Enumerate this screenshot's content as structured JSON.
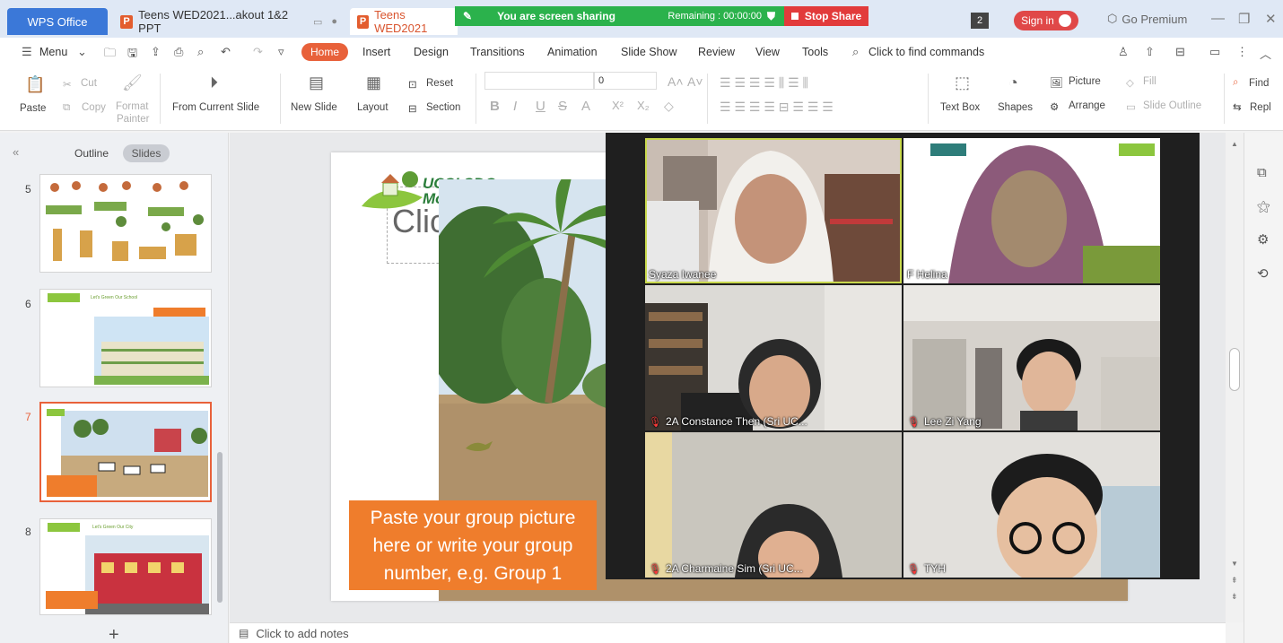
{
  "titlebar": {
    "app_tab": "WPS Office",
    "doc_tab_1": "Teens WED2021...akout 1&2 PPT",
    "doc_tab_2": "Teens WED2021",
    "share_text": "You are screen sharing",
    "remaining": "Remaining : 00:00:00",
    "stop_share": "Stop Share",
    "window_count": "2",
    "sign_in": "Sign in",
    "premium": "Go Premium"
  },
  "menu": {
    "menu_label": "Menu",
    "tabs": [
      "Home",
      "Insert",
      "Design",
      "Transitions",
      "Animation",
      "Slide Show",
      "Review",
      "View",
      "Tools"
    ],
    "search": "Click to find commands"
  },
  "toolbar": {
    "paste": "Paste",
    "cut": "Cut",
    "copy": "Copy",
    "format_painter_1": "Format",
    "format_painter_2": "Painter",
    "from_current": "From Current Slide",
    "new_slide": "New Slide",
    "layout": "Layout",
    "reset": "Reset",
    "section": "Section",
    "font_size": "0",
    "text_box": "Text Box",
    "shapes": "Shapes",
    "picture": "Picture",
    "arrange": "Arrange",
    "fill": "Fill",
    "slide_outline": "Slide Outline",
    "find": "Find",
    "replace": "Repl"
  },
  "sidebar": {
    "outline_tab": "Outline",
    "slides_tab": "Slides",
    "slide_numbers": [
      "5",
      "6",
      "7",
      "8"
    ],
    "thumb_title_6": "Let's Green Our School",
    "thumb_title_8": "Let's Green Our City"
  },
  "slide": {
    "logo_line1": "UCSI SDG",
    "logo_line2": "Month 2021",
    "title_fragment": "Clic",
    "callout": "Paste your group picture here or write your group number, e.g. Group 1"
  },
  "notes": {
    "placeholder": "Click to add notes"
  },
  "meeting": {
    "participants": [
      {
        "name": "Syaza Iwanee",
        "muted": false,
        "active": true
      },
      {
        "name": "F Helina",
        "muted": false,
        "active": false
      },
      {
        "name": "2A Constance Then (Sri UC...",
        "muted": true,
        "active": false
      },
      {
        "name": "Lee Zi Yang",
        "muted": true,
        "active": false
      },
      {
        "name": "2A Charmaine Sim (Sri UC...",
        "muted": true,
        "active": false
      },
      {
        "name": "TYH",
        "muted": true,
        "active": false
      }
    ]
  },
  "colors": {
    "accent": "#e8613a",
    "share_green": "#2bb24c",
    "stop_red": "#e23b3b",
    "callout": "#ef7d2c"
  }
}
